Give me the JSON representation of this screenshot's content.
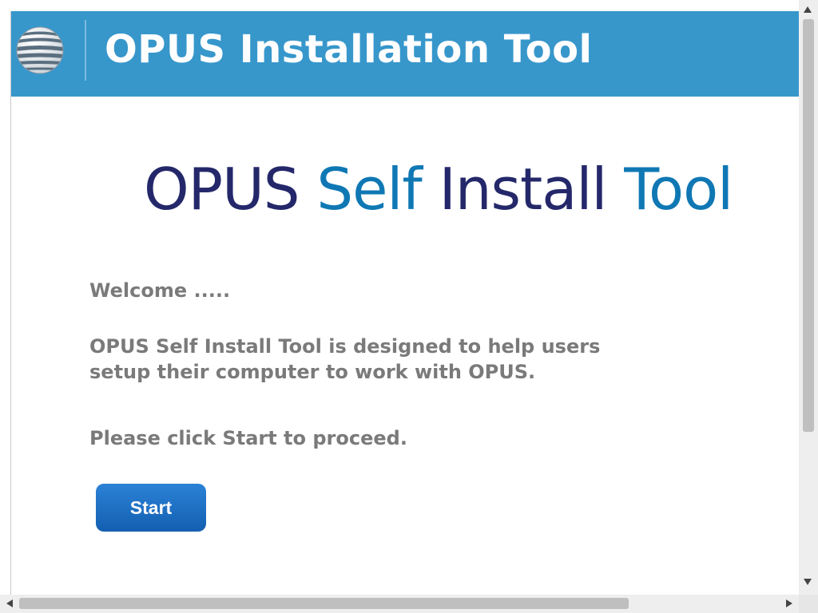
{
  "header": {
    "title": "OPUS Installation Tool",
    "logo_icon": "att-globe-icon"
  },
  "banner": {
    "word1": "OPUS",
    "word2": "Self",
    "word3": "Install",
    "word4": "Tool",
    "colors": {
      "navy": "#24286a",
      "blue": "#0f78b4"
    }
  },
  "content": {
    "welcome": "Welcome .....",
    "description_line1": "OPUS Self Install Tool is designed to help users",
    "description_line2": "setup their computer to work with OPUS.",
    "proceed": "Please click Start to proceed."
  },
  "actions": {
    "start_label": "Start"
  },
  "theme": {
    "header_bg": "#3797cb",
    "button_bg": "#1a6cc2",
    "body_text": "#7a7a7a"
  }
}
